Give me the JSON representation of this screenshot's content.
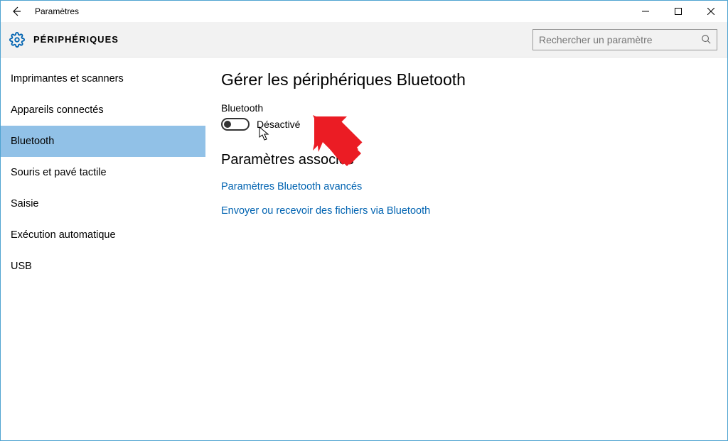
{
  "window": {
    "title": "Paramètres"
  },
  "header": {
    "section": "PÉRIPHÉRIQUES",
    "search_placeholder": "Rechercher un paramètre"
  },
  "sidebar": {
    "items": [
      {
        "label": "Imprimantes et scanners"
      },
      {
        "label": "Appareils connectés"
      },
      {
        "label": "Bluetooth"
      },
      {
        "label": "Souris et pavé tactile"
      },
      {
        "label": "Saisie"
      },
      {
        "label": "Exécution automatique"
      },
      {
        "label": "USB"
      }
    ]
  },
  "content": {
    "title": "Gérer les périphériques Bluetooth",
    "toggle_label": "Bluetooth",
    "toggle_state": "Désactivé",
    "related_heading": "Paramètres associés",
    "link_advanced": "Paramètres Bluetooth avancés",
    "link_sendreceive": "Envoyer ou recevoir des fichiers via Bluetooth"
  }
}
